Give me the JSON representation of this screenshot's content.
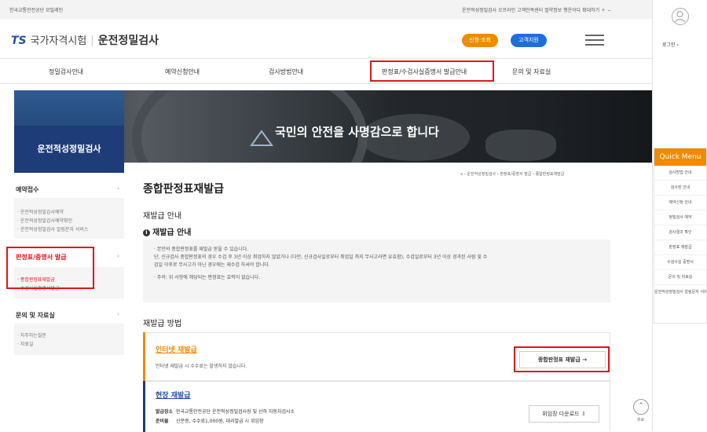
{
  "util": {
    "left_text": "한국교통안전공단  모빌레인",
    "right_links": "운전적성정밀검사  오프라인  고객만족센터  절약정보  행운이다  확대하기  ＋ −"
  },
  "header": {
    "logo_ts": "TS",
    "logo_gukga": "국가자격시험",
    "logo_sep": "|",
    "logo_main": "운전정밀검사",
    "btn_signup": "신청·조회",
    "btn_exam": "고객지원",
    "login_label": "로그인"
  },
  "gnb": [
    "정밀검사안내",
    "예약신청안내",
    "검사방법안내",
    "판정표/수검사실증명서 발급안내",
    "문의 및 자료실"
  ],
  "banner": {
    "headline": "국민의 안전을 사명감으로 합니다"
  },
  "sidebar": {
    "title": "운전적성정밀검사",
    "sections": [
      {
        "label": "예약접수",
        "items": [
          "· 운전적성정밀검사예약",
          "· 운전적성정밀검사예약확인",
          "· 운전적성정밀검사 알림문자 서비스"
        ]
      },
      {
        "label": "판정표/증명서 발급",
        "items": [
          "· 종합판정표재발급",
          "· 수검사실증명서발급"
        ]
      },
      {
        "label": "문의 및 자료실",
        "items": [
          "· 자주하는질문",
          "· 자료실"
        ]
      }
    ]
  },
  "quick": {
    "title": "Quick Menu",
    "items": [
      "검사방법 안내",
      "검사장 안내",
      "예약신청 안내",
      "정밀검사 예약",
      "검사결과 확인",
      "판정표 재발급",
      "수검사실 증명서",
      "문의 및 자료실",
      "운전적성정밀검사 알림문자 서비스"
    ]
  },
  "main": {
    "breadcrumb": "⌂  ›  운전적성정밀검사  ›  판정표/증명서 발급  ›  종합판정표재발급",
    "title": "종합판정표재발급",
    "h_reissue_info": "재발급 안내",
    "h_reissue_info2": "재발급 안내",
    "notice_lines": [
      "· 본인의 종합판정표를 재발급 받을 수 있습니다.",
      "   단, 신규검사 종합판정표의 경우 수검 후 3년 이상 취업하지 않았거나 (다만, 신규검사일로부터 취업일 까지 무사고라면 유효함), 수검일로부터 3년 이상 경과된 사람 및 수",
      "   검일 이후로 무사고가 아닌 경우에는 재수검 하셔야 합니다.",
      "",
      "· 주의: 위 사항에 해당되는 판정표는 효력이 없습니다."
    ],
    "h_method": "재발급 방법",
    "online": {
      "title": "인터넷 재발급",
      "desc": "인터넷 재발급 시 수수료는 발생하지 않습니다.",
      "button": "종합판정표 재발급  →"
    },
    "onsite": {
      "title": "현장 재발급",
      "row1_label": "발급장소",
      "row1_value": "한국교통안전공단 운전적성정밀검사장 및 산하 자동차검사소",
      "row2_label": "준비물",
      "row2_value": "신분증, 수수료1,000원, 대리발급 시 위임장",
      "button": "위임장 다운로드  ⇩"
    },
    "top_label": "위로"
  },
  "colors": {
    "accent_red": "#e0141e",
    "orange": "#f08a00",
    "navy": "#1d3c78",
    "blue_pill": "#1e6fd9"
  }
}
